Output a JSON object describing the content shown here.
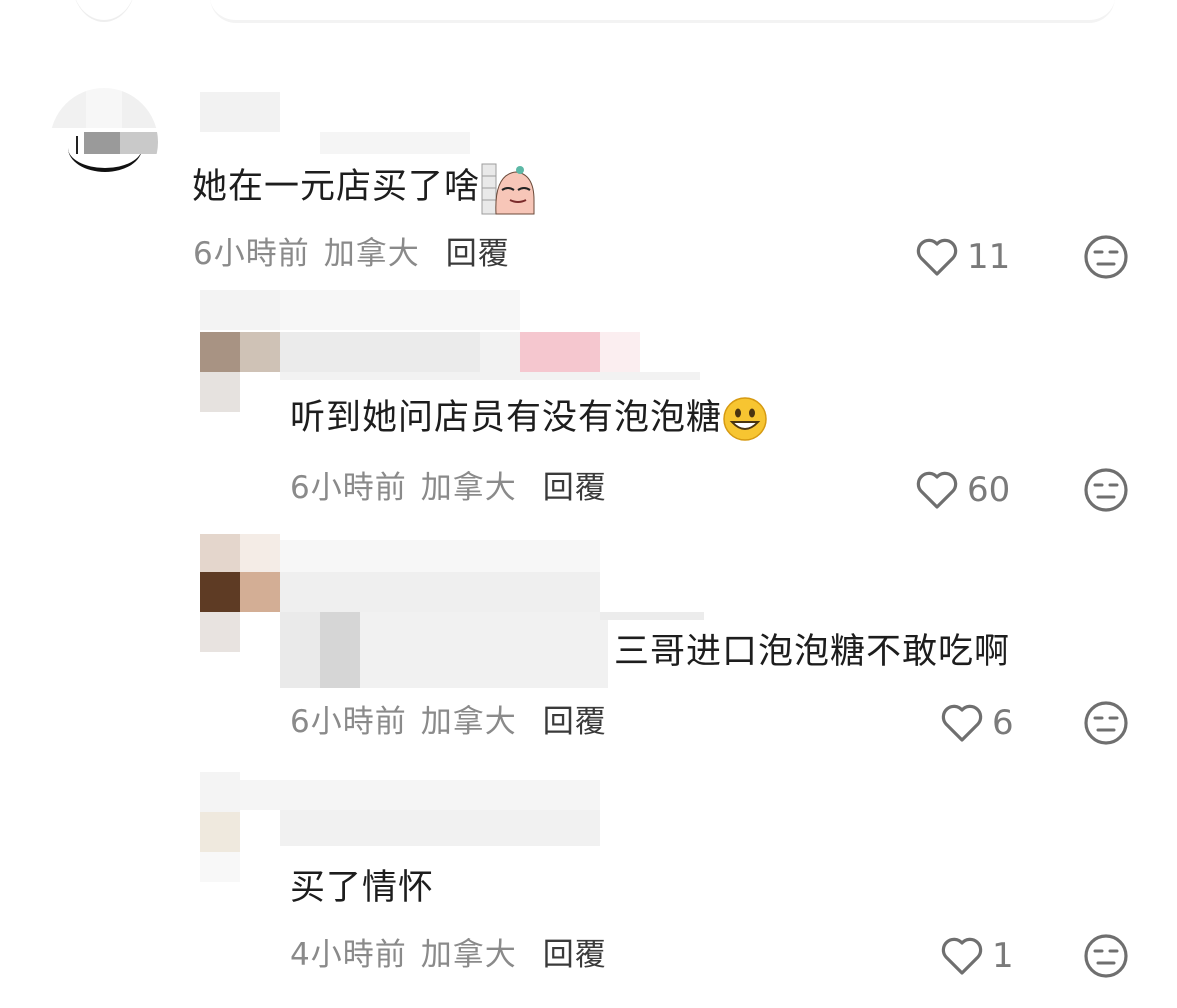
{
  "comments": [
    {
      "text": "她在一元店买了啥",
      "time": "6小時前",
      "location": "加拿大",
      "reply_label": "回覆",
      "likes": "11"
    },
    {
      "text": "听到她问店员有没有泡泡糖",
      "time": "6小時前",
      "location": "加拿大",
      "reply_label": "回覆",
      "likes": "60"
    },
    {
      "text": "三哥进口泡泡糖不敢吃啊",
      "time": "6小時前",
      "location": "加拿大",
      "reply_label": "回覆",
      "likes": "6"
    },
    {
      "text": "买了情怀",
      "time": "4小時前",
      "location": "加拿大",
      "reply_label": "回覆",
      "likes": "1"
    }
  ],
  "icons": {
    "like": "heart-outline-icon",
    "reaction": "neutral-face-icon"
  },
  "colors": {
    "text": "#1d1d1d",
    "meta": "#8a8a8a",
    "icon": "#6f6f6f"
  }
}
